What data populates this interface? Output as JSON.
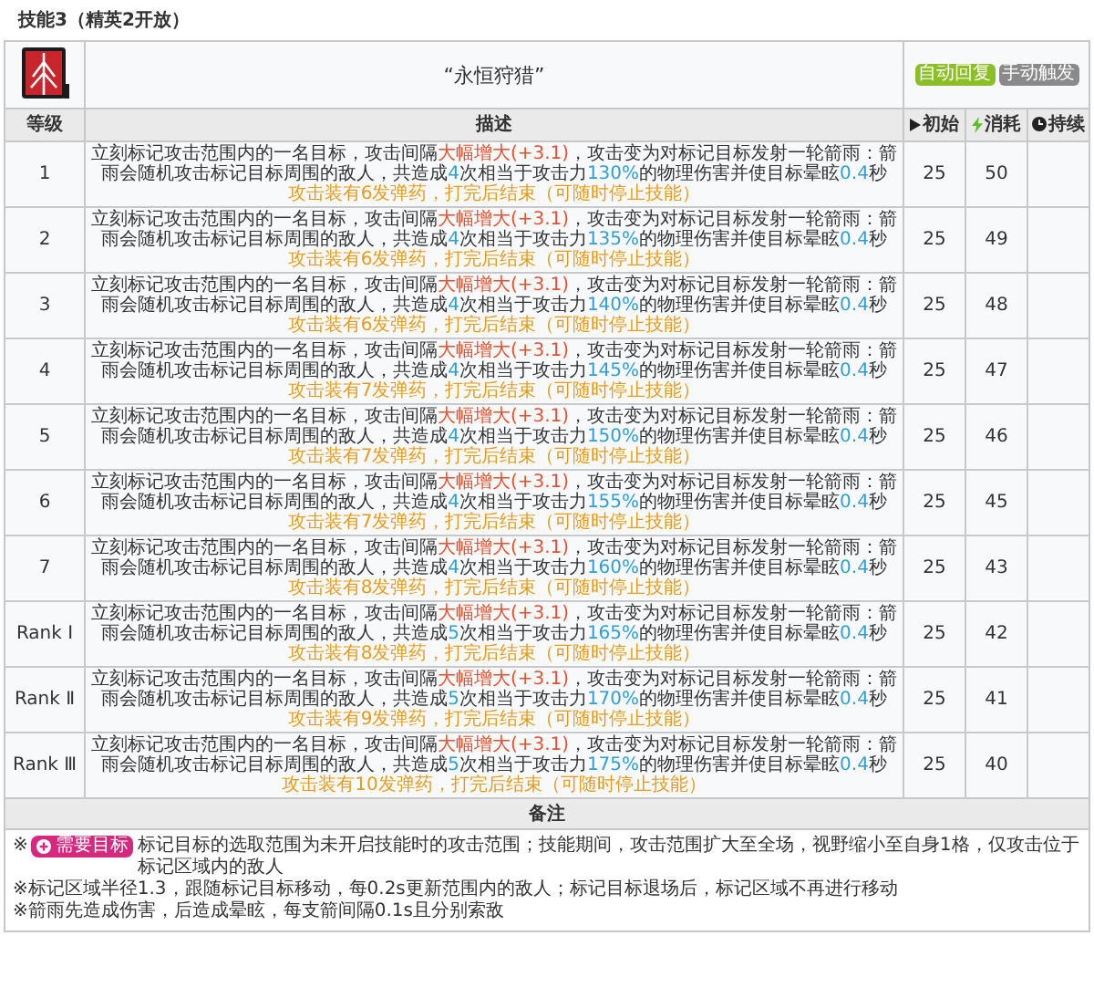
{
  "section_title": "技能3（精英2开放）",
  "skill": {
    "name": "“永恒狩猎”",
    "tags": [
      {
        "label": "自动回复",
        "color": "#8cbf26"
      },
      {
        "label": "手动触发",
        "color": "#8a8a8a"
      }
    ]
  },
  "columns": [
    {
      "label": "等级"
    },
    {
      "label": "描述"
    },
    {
      "label": "初始"
    },
    {
      "label": "消耗"
    },
    {
      "label": "持续"
    }
  ],
  "rows": [
    {
      "level": "1",
      "desc": [
        {
          "text": "立刻标记攻击范围内的一名目标，攻击间隔",
          "kind": "plain"
        },
        {
          "text": "大幅增大(+3.1)",
          "kind": "increase"
        },
        {
          "text": "，攻击变为对标记目标发射一轮箭雨：箭雨会随机攻击标记目标周围的敌人，共造成",
          "kind": "plain"
        },
        {
          "text": "4",
          "kind": "value"
        },
        {
          "text": "次相当于攻击力",
          "kind": "plain"
        },
        {
          "text": "130%",
          "kind": "value"
        },
        {
          "text": "的物理伤害并使目标晕眩",
          "kind": "plain"
        },
        {
          "text": "0.4",
          "kind": "value"
        },
        {
          "text": "秒",
          "kind": "plain"
        }
      ],
      "ammo": "攻击装有6发弹药，打完后结束（可随时停止技能）",
      "initial": "25",
      "cost": "50"
    },
    {
      "level": "2",
      "desc": [
        {
          "text": "立刻标记攻击范围内的一名目标，攻击间隔",
          "kind": "plain"
        },
        {
          "text": "大幅增大(+3.1)",
          "kind": "increase"
        },
        {
          "text": "，攻击变为对标记目标发射一轮箭雨：箭雨会随机攻击标记目标周围的敌人，共造成",
          "kind": "plain"
        },
        {
          "text": "4",
          "kind": "value"
        },
        {
          "text": "次相当于攻击力",
          "kind": "plain"
        },
        {
          "text": "135%",
          "kind": "value"
        },
        {
          "text": "的物理伤害并使目标晕眩",
          "kind": "plain"
        },
        {
          "text": "0.4",
          "kind": "value"
        },
        {
          "text": "秒",
          "kind": "plain"
        }
      ],
      "ammo": "攻击装有6发弹药，打完后结束（可随时停止技能）",
      "initial": "25",
      "cost": "49"
    },
    {
      "level": "3",
      "desc": [
        {
          "text": "立刻标记攻击范围内的一名目标，攻击间隔",
          "kind": "plain"
        },
        {
          "text": "大幅增大(+3.1)",
          "kind": "increase"
        },
        {
          "text": "，攻击变为对标记目标发射一轮箭雨：箭雨会随机攻击标记目标周围的敌人，共造成",
          "kind": "plain"
        },
        {
          "text": "4",
          "kind": "value"
        },
        {
          "text": "次相当于攻击力",
          "kind": "plain"
        },
        {
          "text": "140%",
          "kind": "value"
        },
        {
          "text": "的物理伤害并使目标晕眩",
          "kind": "plain"
        },
        {
          "text": "0.4",
          "kind": "value"
        },
        {
          "text": "秒",
          "kind": "plain"
        }
      ],
      "ammo": "攻击装有6发弹药，打完后结束（可随时停止技能）",
      "initial": "25",
      "cost": "48"
    },
    {
      "level": "4",
      "desc": [
        {
          "text": "立刻标记攻击范围内的一名目标，攻击间隔",
          "kind": "plain"
        },
        {
          "text": "大幅增大(+3.1)",
          "kind": "increase"
        },
        {
          "text": "，攻击变为对标记目标发射一轮箭雨：箭雨会随机攻击标记目标周围的敌人，共造成",
          "kind": "plain"
        },
        {
          "text": "4",
          "kind": "value"
        },
        {
          "text": "次相当于攻击力",
          "kind": "plain"
        },
        {
          "text": "145%",
          "kind": "value"
        },
        {
          "text": "的物理伤害并使目标晕眩",
          "kind": "plain"
        },
        {
          "text": "0.4",
          "kind": "value"
        },
        {
          "text": "秒",
          "kind": "plain"
        }
      ],
      "ammo": "攻击装有7发弹药，打完后结束（可随时停止技能）",
      "initial": "25",
      "cost": "47"
    },
    {
      "level": "5",
      "desc": [
        {
          "text": "立刻标记攻击范围内的一名目标，攻击间隔",
          "kind": "plain"
        },
        {
          "text": "大幅增大(+3.1)",
          "kind": "increase"
        },
        {
          "text": "，攻击变为对标记目标发射一轮箭雨：箭雨会随机攻击标记目标周围的敌人，共造成",
          "kind": "plain"
        },
        {
          "text": "4",
          "kind": "value"
        },
        {
          "text": "次相当于攻击力",
          "kind": "plain"
        },
        {
          "text": "150%",
          "kind": "value"
        },
        {
          "text": "的物理伤害并使目标晕眩",
          "kind": "plain"
        },
        {
          "text": "0.4",
          "kind": "value"
        },
        {
          "text": "秒",
          "kind": "plain"
        }
      ],
      "ammo": "攻击装有7发弹药，打完后结束（可随时停止技能）",
      "initial": "25",
      "cost": "46"
    },
    {
      "level": "6",
      "desc": [
        {
          "text": "立刻标记攻击范围内的一名目标，攻击间隔",
          "kind": "plain"
        },
        {
          "text": "大幅增大(+3.1)",
          "kind": "increase"
        },
        {
          "text": "，攻击变为对标记目标发射一轮箭雨：箭雨会随机攻击标记目标周围的敌人，共造成",
          "kind": "plain"
        },
        {
          "text": "4",
          "kind": "value"
        },
        {
          "text": "次相当于攻击力",
          "kind": "plain"
        },
        {
          "text": "155%",
          "kind": "value"
        },
        {
          "text": "的物理伤害并使目标晕眩",
          "kind": "plain"
        },
        {
          "text": "0.4",
          "kind": "value"
        },
        {
          "text": "秒",
          "kind": "plain"
        }
      ],
      "ammo": "攻击装有7发弹药，打完后结束（可随时停止技能）",
      "initial": "25",
      "cost": "45"
    },
    {
      "level": "7",
      "desc": [
        {
          "text": "立刻标记攻击范围内的一名目标，攻击间隔",
          "kind": "plain"
        },
        {
          "text": "大幅增大(+3.1)",
          "kind": "increase"
        },
        {
          "text": "，攻击变为对标记目标发射一轮箭雨：箭雨会随机攻击标记目标周围的敌人，共造成",
          "kind": "plain"
        },
        {
          "text": "4",
          "kind": "value"
        },
        {
          "text": "次相当于攻击力",
          "kind": "plain"
        },
        {
          "text": "160%",
          "kind": "value"
        },
        {
          "text": "的物理伤害并使目标晕眩",
          "kind": "plain"
        },
        {
          "text": "0.4",
          "kind": "value"
        },
        {
          "text": "秒",
          "kind": "plain"
        }
      ],
      "ammo": "攻击装有8发弹药，打完后结束（可随时停止技能）",
      "initial": "25",
      "cost": "43"
    },
    {
      "level": "Rank Ⅰ",
      "desc": [
        {
          "text": "立刻标记攻击范围内的一名目标，攻击间隔",
          "kind": "plain"
        },
        {
          "text": "大幅增大(+3.1)",
          "kind": "increase"
        },
        {
          "text": "，攻击变为对标记目标发射一轮箭雨：箭雨会随机攻击标记目标周围的敌人，共造成",
          "kind": "plain"
        },
        {
          "text": "5",
          "kind": "value"
        },
        {
          "text": "次相当于攻击力",
          "kind": "plain"
        },
        {
          "text": "165%",
          "kind": "value"
        },
        {
          "text": "的物理伤害并使目标晕眩",
          "kind": "plain"
        },
        {
          "text": "0.4",
          "kind": "value"
        },
        {
          "text": "秒",
          "kind": "plain"
        }
      ],
      "ammo": "攻击装有8发弹药，打完后结束（可随时停止技能）",
      "initial": "25",
      "cost": "42"
    },
    {
      "level": "Rank Ⅱ",
      "desc": [
        {
          "text": "立刻标记攻击范围内的一名目标，攻击间隔",
          "kind": "plain"
        },
        {
          "text": "大幅增大(+3.1)",
          "kind": "increase"
        },
        {
          "text": "，攻击变为对标记目标发射一轮箭雨：箭雨会随机攻击标记目标周围的敌人，共造成",
          "kind": "plain"
        },
        {
          "text": "5",
          "kind": "value"
        },
        {
          "text": "次相当于攻击力",
          "kind": "plain"
        },
        {
          "text": "170%",
          "kind": "value"
        },
        {
          "text": "的物理伤害并使目标晕眩",
          "kind": "plain"
        },
        {
          "text": "0.4",
          "kind": "value"
        },
        {
          "text": "秒",
          "kind": "plain"
        }
      ],
      "ammo": "攻击装有9发弹药，打完后结束（可随时停止技能）",
      "initial": "25",
      "cost": "41"
    },
    {
      "level": "Rank Ⅲ",
      "desc": [
        {
          "text": "立刻标记攻击范围内的一名目标，攻击间隔",
          "kind": "plain"
        },
        {
          "text": "大幅增大(+3.1)",
          "kind": "increase"
        },
        {
          "text": "，攻击变为对标记目标发射一轮箭雨：箭雨会随机攻击标记目标周围的敌人，共造成",
          "kind": "plain"
        },
        {
          "text": "5",
          "kind": "value"
        },
        {
          "text": "次相当于攻击力",
          "kind": "plain"
        },
        {
          "text": "175%",
          "kind": "value"
        },
        {
          "text": "的物理伤害并使目标晕眩",
          "kind": "plain"
        },
        {
          "text": "0.4",
          "kind": "value"
        },
        {
          "text": "秒",
          "kind": "plain"
        }
      ],
      "ammo": "攻击装有10发弹药，打完后结束（可随时停止技能）",
      "initial": "25",
      "cost": "40"
    }
  ],
  "notes": {
    "title": "备注",
    "items": [
      {
        "prefix": "※",
        "badge": "需要目标",
        "text": "标记目标的选取范围为未开启技能时的攻击范围；技能期间，攻击范围扩大至全场，视野缩小至自身1格，仅攻击位于标记区域内的敌人"
      },
      {
        "text": "※标记区域半径1.3，跟随标记目标移动，每0.2s更新范围内的敌人；标记目标退场后，标记区域不再进行移动"
      },
      {
        "text": "※箭雨先造成伤害，后造成晕眩，每支箭间隔0.1s且分别索敌"
      }
    ]
  }
}
